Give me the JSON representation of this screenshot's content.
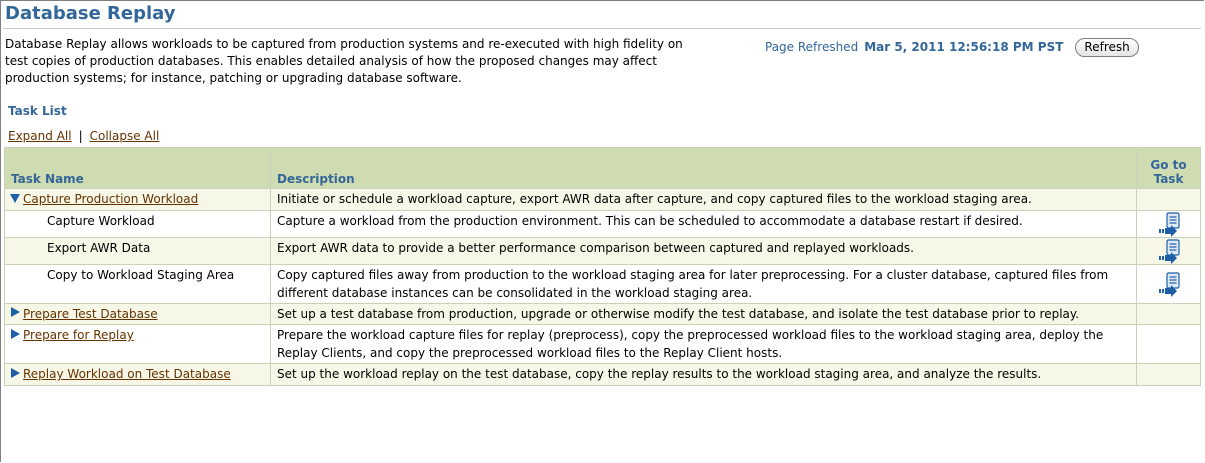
{
  "page": {
    "title": "Database Replay",
    "description": "Database Replay allows workloads to be captured from production systems and re-executed with high fidelity on test copies of production databases. This enables detailed analysis of how the proposed changes may affect production systems; for instance, patching or upgrading database software.",
    "refreshed_label": "Page Refreshed",
    "refreshed_time": "Mar 5, 2011 12:56:18 PM PST",
    "refresh_button": "Refresh"
  },
  "task_list": {
    "label": "Task List",
    "expand_all": "Expand All",
    "separator": "|",
    "collapse_all": "Collapse All",
    "headers": {
      "task_name": "Task Name",
      "description": "Description",
      "go_to_task": "Go to Task"
    },
    "rows": [
      {
        "name": "Capture Production Workload",
        "level": "top",
        "state": "expanded",
        "description": "Initiate or schedule a workload capture, export AWR data after capture, and copy captured files to the workload staging area.",
        "has_goto": false
      },
      {
        "name": "Capture Workload",
        "level": "sub",
        "description": "Capture a workload from the production environment. This can be scheduled to accommodate a database restart if desired.",
        "has_goto": true
      },
      {
        "name": "Export AWR Data",
        "level": "sub",
        "description": "Export AWR data to provide a better performance comparison between captured and replayed workloads.",
        "has_goto": true
      },
      {
        "name": "Copy to Workload Staging Area",
        "level": "sub",
        "description": "Copy captured files away from production to the workload staging area for later preprocessing. For a cluster database, captured files from different database instances can be consolidated in the workload staging area.",
        "has_goto": true
      },
      {
        "name": "Prepare Test Database",
        "level": "top",
        "state": "collapsed",
        "description": "Set up a test database from production, upgrade or otherwise modify the test database, and isolate the test database prior to replay.",
        "has_goto": false
      },
      {
        "name": "Prepare for Replay",
        "level": "top",
        "state": "collapsed",
        "description": "Prepare the workload capture files for replay (preprocess), copy the preprocessed workload files to the workload staging area, deploy the Replay Clients, and copy the preprocessed workload files to the Replay Client hosts.",
        "has_goto": false
      },
      {
        "name": "Replay Workload on Test Database",
        "level": "top",
        "state": "collapsed",
        "description": "Set up the workload replay on the test database, copy the replay results to the workload staging area, and analyze the results.",
        "has_goto": false
      }
    ]
  },
  "colors": {
    "title_blue": "#336699",
    "link_brown": "#663300",
    "header_bg": "#cfdbb1",
    "row_alt_bg": "#f7f7e7",
    "icon_blue": "#1f5fa8"
  },
  "icons": {
    "expanded": "triangle-down-icon",
    "collapsed": "triangle-right-icon",
    "go_to_task": "go-to-task-icon"
  }
}
